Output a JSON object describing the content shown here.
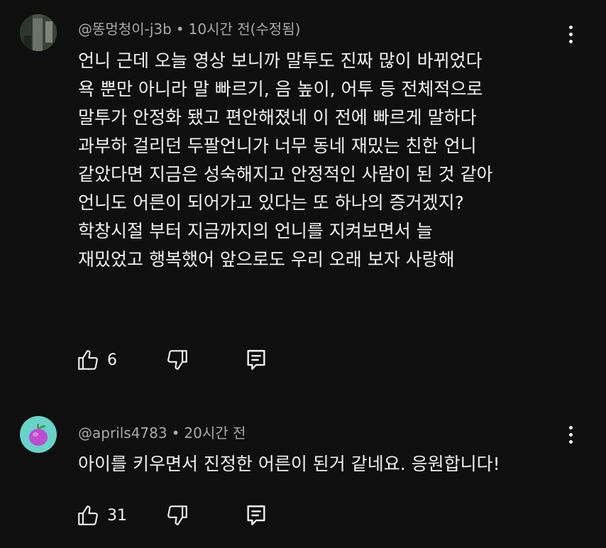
{
  "comments": [
    {
      "author": "@똥멍청이-j3b",
      "separator": "•",
      "time": "10시간 전(수정됨)",
      "lines": [
        "언니 근데 오늘 영상 보니까 말투도 진짜 많이 바뀌었다",
        "욕 뿐만 아니라 말 빠르기, 음 높이, 어투 등 전체적으로",
        "말투가 안정화 됐고 편안해졌네 이 전에 빠르게 말하다",
        "과부하 걸리던 두팔언니가 너무 동네 재밌는 친한 언니",
        "같았다면 지금은 성숙해지고 안정적인 사람이 된 것 같아",
        "언니도 어른이 되어가고 있다는 또 하나의 증거겠지?",
        "학창시절 부터 지금까지의 언니를 지켜보면서 늘",
        "재밌었고 행복했어 앞으로도 우리 오래 보자 사랑해"
      ],
      "likes": "6",
      "avatar_icon": "photo-avatar-icon"
    },
    {
      "author": "@aprils4783",
      "separator": "•",
      "time": "20시간 전",
      "lines": [
        "아이를 키우면서 진정한 어른이 된거 같네요. 응원합니다!"
      ],
      "likes": "31",
      "avatar_icon": "plum-avatar-icon"
    }
  ],
  "icons": {
    "like": "thumbs-up-icon",
    "dislike": "thumbs-down-icon",
    "reply": "reply-icon",
    "more": "more-vertical-icon"
  },
  "colors": {
    "background": "#0f0f0f",
    "text_primary": "#f1f1f1",
    "text_secondary": "#aaaaaa",
    "avatar2_bg": "#67d3c9",
    "avatar2_fruit": "#c04bd0"
  }
}
